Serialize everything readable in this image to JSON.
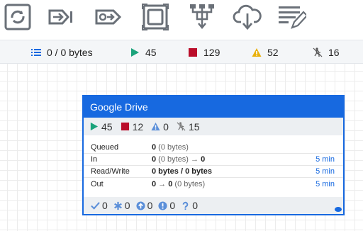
{
  "toolbar": {
    "tools": [
      {
        "icon": "processor-icon"
      },
      {
        "icon": "input-port-icon"
      },
      {
        "icon": "output-port-icon"
      },
      {
        "icon": "process-group-icon"
      },
      {
        "icon": "remote-process-group-icon"
      },
      {
        "icon": "funnel-icon"
      },
      {
        "icon": "template-icon"
      },
      {
        "icon": "label-icon"
      }
    ]
  },
  "status": {
    "queued": "0 / 0 bytes",
    "running": "45",
    "stopped": "129",
    "invalid": "52",
    "disabled": "16"
  },
  "card": {
    "title": "Google Drive",
    "counts": {
      "running": "45",
      "stopped": "12",
      "invalid": "0",
      "disabled": "15"
    },
    "rows": [
      {
        "label": "Queued",
        "value_bold": "0",
        "value_rest": " (0 bytes)",
        "age": ""
      },
      {
        "label": "In",
        "value_bold": "0",
        "value_rest": " (0 bytes) → ",
        "value_bold2": "0",
        "age": "5 min"
      },
      {
        "label": "Read/Write",
        "value_bold": "0 bytes / 0 bytes",
        "value_rest": "",
        "age": "5 min"
      },
      {
        "label": "Out",
        "value_bold": "0",
        "value_rest": " → ",
        "value_bold2": "0",
        "value_rest2": " (0 bytes)",
        "age": "5 min"
      }
    ],
    "footer": {
      "up_to_date": "0",
      "locally_modified": "0",
      "stale": "0",
      "locally_modified_stale": "0",
      "sync_failure": "0"
    }
  },
  "colors": {
    "accent": "#1769e0",
    "running": "#1ba37b",
    "stopped": "#ba0d2a",
    "invalid": "#e9b10c",
    "icon_gray": "#6a7078",
    "footer_icon": "#5b8fd9"
  }
}
